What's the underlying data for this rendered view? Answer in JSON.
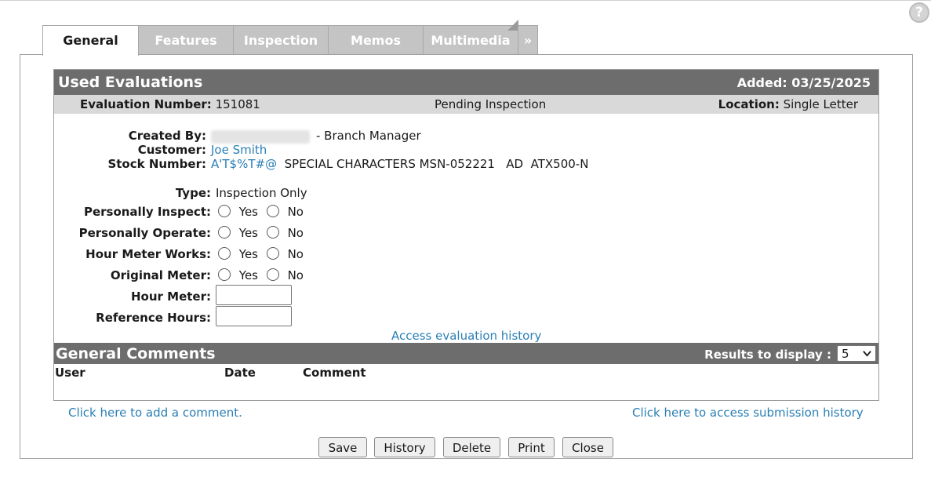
{
  "help": {
    "glyph": "?"
  },
  "tabs": [
    {
      "label": "General",
      "active": true
    },
    {
      "label": "Features",
      "active": false
    },
    {
      "label": "Inspection",
      "active": false
    },
    {
      "label": "Memos",
      "active": false
    },
    {
      "label": "Multimedia",
      "active": false
    },
    {
      "label": "»",
      "active": false
    }
  ],
  "panel": {
    "title": "Used Evaluations",
    "added": "Added: 03/25/2025"
  },
  "info": {
    "eval_label": "Evaluation Number:",
    "eval_value": "151081",
    "status": "Pending Inspection",
    "location_label": "Location:",
    "location_value": "Single Letter"
  },
  "details": {
    "created_label": "Created By:",
    "created_role": "- Branch Manager",
    "customer_label": "Customer:",
    "customer_value": "Joe Smith",
    "stock_label": "Stock Number:",
    "stock_link": "A'T$%T#@",
    "stock_desc": "SPECIAL CHARACTERS MSN-052221   AD  ATX500-N",
    "type_label": "Type:",
    "type_value": "Inspection Only"
  },
  "radio_rows": [
    {
      "label": "Personally Inspect:",
      "yes": "Yes",
      "no": "No"
    },
    {
      "label": "Personally Operate:",
      "yes": "Yes",
      "no": "No"
    },
    {
      "label": "Hour Meter Works:",
      "yes": "Yes",
      "no": "No"
    },
    {
      "label": "Original Meter:",
      "yes": "Yes",
      "no": "No"
    }
  ],
  "inputs": {
    "hour_meter_label": "Hour Meter:",
    "hour_meter_value": "",
    "reference_hours_label": "Reference Hours:",
    "reference_hours_value": ""
  },
  "history_link": "Access evaluation history",
  "comments": {
    "title": "General Comments",
    "results_label": "Results to display :",
    "results_value": "5",
    "columns": [
      "User",
      "Date",
      "Comment"
    ]
  },
  "links": {
    "add_comment": "Click here to add a comment.",
    "submission_history": "Click here to access submission history"
  },
  "buttons": {
    "save": "Save",
    "history": "History",
    "delete": "Delete",
    "print": "Print",
    "close": "Close"
  }
}
